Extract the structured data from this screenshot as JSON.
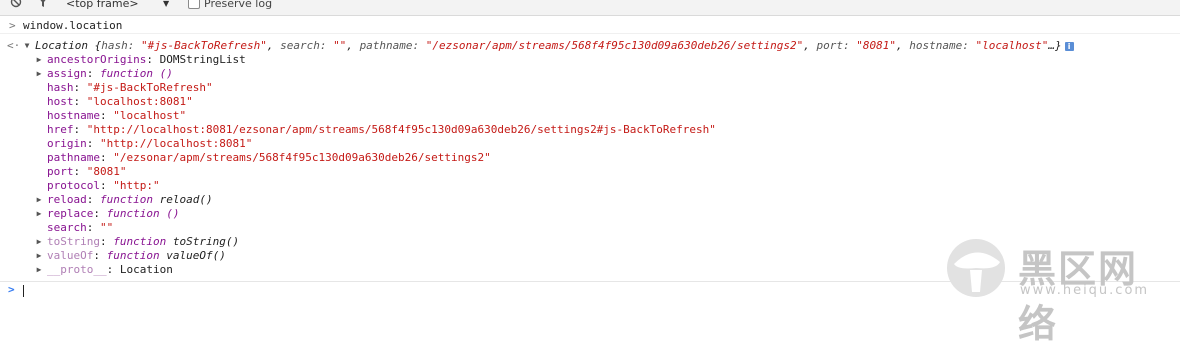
{
  "toolbar": {
    "context": "<top frame>",
    "preserve_log_label": "Preserve log"
  },
  "console": {
    "command": "window.location",
    "summary": {
      "type": "Location",
      "entries": [
        {
          "k": "hash",
          "v": "\"#js-BackToRefresh\""
        },
        {
          "k": "search",
          "v": "\"\""
        },
        {
          "k": "pathname",
          "v": "\"/ezsonar/apm/streams/568f4f95c130d09a630deb26/settings2\""
        },
        {
          "k": "port",
          "v": "\"8081\""
        },
        {
          "k": "hostname",
          "v": "\"localhost\""
        }
      ],
      "ellipsis": "…}",
      "info": "i"
    },
    "properties": [
      {
        "key": "ancestorOrigins",
        "value": "DOMStringList",
        "kind": "plain",
        "expandable": true
      },
      {
        "key": "assign",
        "value": "function ()",
        "kind": "fn",
        "fname": "",
        "expandable": true
      },
      {
        "key": "hash",
        "value": "\"#js-BackToRefresh\"",
        "kind": "str",
        "expandable": false
      },
      {
        "key": "host",
        "value": "\"localhost:8081\"",
        "kind": "str",
        "expandable": false
      },
      {
        "key": "hostname",
        "value": "\"localhost\"",
        "kind": "str",
        "expandable": false
      },
      {
        "key": "href",
        "value": "\"http://localhost:8081/ezsonar/apm/streams/568f4f95c130d09a630deb26/settings2#js-BackToRefresh\"",
        "kind": "str",
        "expandable": false
      },
      {
        "key": "origin",
        "value": "\"http://localhost:8081\"",
        "kind": "str",
        "expandable": false
      },
      {
        "key": "pathname",
        "value": "\"/ezsonar/apm/streams/568f4f95c130d09a630deb26/settings2\"",
        "kind": "str",
        "expandable": false
      },
      {
        "key": "port",
        "value": "\"8081\"",
        "kind": "str",
        "expandable": false
      },
      {
        "key": "protocol",
        "value": "\"http:\"",
        "kind": "str",
        "expandable": false
      },
      {
        "key": "reload",
        "value": "function",
        "kind": "fn",
        "fname": "reload()",
        "expandable": true
      },
      {
        "key": "replace",
        "value": "function ()",
        "kind": "fn",
        "fname": "",
        "expandable": true
      },
      {
        "key": "search",
        "value": "\"\"",
        "kind": "str",
        "expandable": false
      },
      {
        "key": "toString",
        "value": "function",
        "kind": "fn",
        "fname": "toString()",
        "expandable": true,
        "dim": true
      },
      {
        "key": "valueOf",
        "value": "function",
        "kind": "fn",
        "fname": "valueOf()",
        "expandable": true,
        "dim": true
      },
      {
        "key": "__proto__",
        "value": "Location",
        "kind": "plain",
        "expandable": true,
        "dim": true
      }
    ]
  },
  "watermark": {
    "name_cn": "黑区网络",
    "url": "www.heiqu.com"
  }
}
